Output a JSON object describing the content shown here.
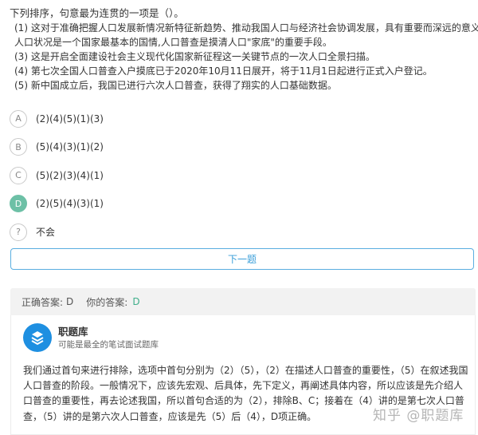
{
  "question": {
    "title": "下列排序，句意最为连贯的一项是（）。",
    "statements": [
      "(1) 这对于准确把握人口发展新情况新特征新趋势、推动我国人口与经济社会协调发展，具有重要而深远的意义",
      "人口状况是一个国家最基本的国情,人口普查是摸清人口\"家底\"的重要手段。",
      "(3) 这是开启全面建设社会主义现代化国家新征程这一关键节点的一次人口全景扫描。",
      "(4) 第七次全国人口普查入户摸底已于2020年10月11日展开，将于11月1日起进行正式入户登记。",
      "(5) 新中国成立后，我国已进行六次人口普查，获得了翔实的人口基础数据。"
    ]
  },
  "options": [
    {
      "letter": "A",
      "text": "(2)(4)(5)(1)(3)",
      "selected": false
    },
    {
      "letter": "B",
      "text": "(5)(4)(3)(1)(2)",
      "selected": false
    },
    {
      "letter": "C",
      "text": "(5)(2)(3)(4)(1)",
      "selected": false
    },
    {
      "letter": "D",
      "text": "(2)(5)(4)(3)(1)",
      "selected": true
    },
    {
      "letter": "?",
      "text": "不会",
      "selected": false
    }
  ],
  "next_button": "下一题",
  "answer": {
    "correct_label": "正确答案:",
    "correct_value": "D",
    "your_label": "你的答案:",
    "your_value": "D"
  },
  "brand": {
    "name": "职题库",
    "subtitle": "可能是最全的笔试面试题库"
  },
  "explanation": "我们通过首句来进行排除，选项中首句分别为（2）（5），（2）在描述人口普查的重要性，（5）在叙述我国人口普查的阶段。一般情况下，应该先宏观、后具体，先下定义，再阐述具体内容，所以应该是先介绍人口普查的重要性，再去论述我国，所以首句合适的为（2），排除B、C；接着在（4）讲的是第七次人口普查，（5）讲的是第六次人口普查，应该是先（5）后（4），D项正确。",
  "watermark": "知乎 @职题库",
  "colors": {
    "selected_option": "#6dc0a6",
    "next_button_border": "#5aaee0",
    "your_answer": "#3fae8a",
    "brand_logo": "#1e8fe1"
  }
}
